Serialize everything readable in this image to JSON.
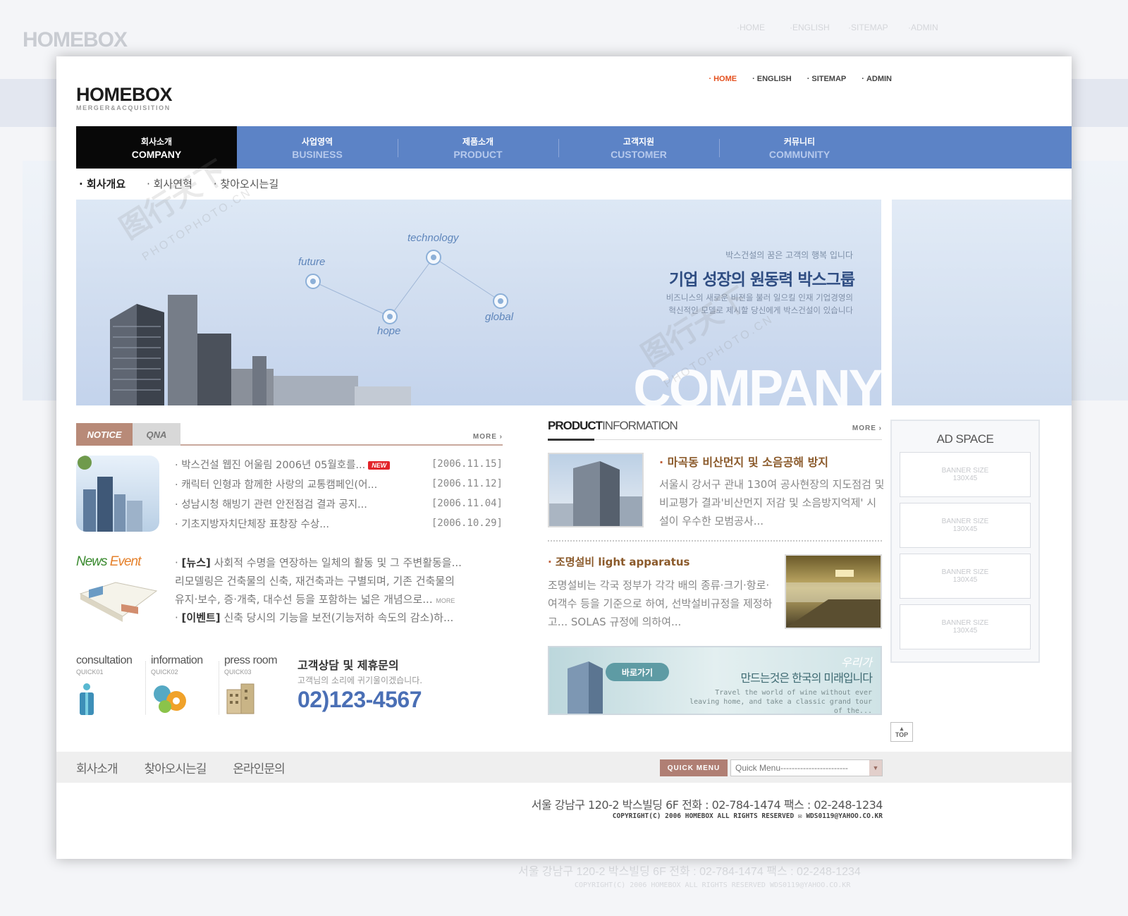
{
  "background": {
    "logo": "HOMEBOX",
    "nav": [
      "·HOME",
      "·ENGLISH",
      "·SITEMAP",
      "·ADMIN"
    ],
    "address": "서울 강남구 120-2 박스빌딩 6F    전화 : 02-784-1474    팩스 : 02-248-1234",
    "copyright": "COPYRIGHT(C) 2006 HOMEBOX ALL RIGHTS RESERVED  WDS0119@YAHOO.CO.KR"
  },
  "header": {
    "logo_main": "HOMEBOX",
    "logo_sub": "MERGER&ACQUISITION",
    "top_nav": [
      {
        "label": "HOME",
        "active": true
      },
      {
        "label": "ENGLISH",
        "active": false
      },
      {
        "label": "SITEMAP",
        "active": false
      },
      {
        "label": "ADMIN",
        "active": false
      }
    ]
  },
  "main_nav": [
    {
      "ko": "회사소개",
      "en": "COMPANY",
      "active": true
    },
    {
      "ko": "사업영역",
      "en": "BUSINESS",
      "active": false
    },
    {
      "ko": "제품소개",
      "en": "PRODUCT",
      "active": false
    },
    {
      "ko": "고객지원",
      "en": "CUSTOMER",
      "active": false
    },
    {
      "ko": "커뮤니티",
      "en": "COMMUNITY",
      "active": false
    }
  ],
  "sub_nav": [
    {
      "label": "회사개요",
      "active": true
    },
    {
      "label": "회사연혁",
      "active": false
    },
    {
      "label": "찾아오시는길",
      "active": false
    }
  ],
  "banner": {
    "nodes": [
      "future",
      "technology",
      "hope",
      "global"
    ],
    "subtitle": "박스건설의 꿈은 고객의 행복 입니다",
    "title": "기업 성장의 원동력 박스그룹",
    "desc1": "비즈니스의 새로운 비젼을 불러 일으킬 인재 기업경영의",
    "desc2": "혁신적인 모델로 제시할 당신에게 박스건설이 있습니다",
    "big_word": "COMPANY"
  },
  "notice": {
    "tabs": [
      "NOTICE",
      "QNA"
    ],
    "more": "MORE ›",
    "new_badge": "NEW",
    "items": [
      {
        "title": "박스건설 웹진 어울림 2006년 05월호를...",
        "date": "[2006.11.15]"
      },
      {
        "title": "캐릭터 인형과 함께한 사랑의 교통캠페인(어...",
        "date": "[2006.11.12]"
      },
      {
        "title": "성남시청 해빙기 관련 안전점검 결과 공지...",
        "date": "[2006.11.04]"
      },
      {
        "title": "기초지방자치단체장 표창장 수상...",
        "date": "[2006.10.29]"
      }
    ]
  },
  "news": {
    "title_a": "News",
    "title_b": "Event",
    "item1_tag": "[뉴스]",
    "item1_line1": " 사회적 수명을 연장하는 일체의 활동 및 그 주변활동을...",
    "item1_line2": "리모델링은 건축물의 신축, 재건축과는 구별되며, 기존 건축물의",
    "item1_line3": "유지·보수, 증·개축, 대수선 등을 포함하는 넓은 개념으로... ",
    "more": "MORE",
    "item2_tag": "[이벤트]",
    "item2_line1": " 신축 당시의 기능을 보전(기능저하 속도의 감소)하..."
  },
  "quick": [
    {
      "title": "consultation",
      "sub": "QUICK01"
    },
    {
      "title": "information",
      "sub": "QUICK02"
    },
    {
      "title": "press room",
      "sub": "QUICK03"
    }
  ],
  "contact": {
    "title": "고객상담 및 제휴문의",
    "sub": "고객님의 소리에 귀기울이겠습니다.",
    "phone": "02)123-4567"
  },
  "product": {
    "head_bold": "PRODUCT",
    "head_rest": "INFORMATION",
    "more": "MORE ›",
    "item1_title": "마곡동 비산먼지 및 소음공해 방지",
    "item1_desc": "서울시 강서구 관내 130여 공사현장의 지도점검 및 비교평가 결과'비산먼지 저감 및 소음방지억제' 시설이 우수한 모범공사...",
    "item2_title": "조명설비 light apparatus",
    "item2_desc": "조명설비는 각국 정부가 각각 배의 종류·크기·항로·여객수 등을 기준으로 하여, 선박설비규정을 제정하고... SOLAS 규정에 의하여..."
  },
  "promo": {
    "button": "바로가기",
    "tag": "우리가",
    "title": "만드는것은 한국의 미래입니다",
    "en": "Travel the world of wine without ever leaving home, and take a classic grand tour of the..."
  },
  "ad": {
    "title": "AD SPACE",
    "slots": [
      {
        "l1": "BANNER SIZE",
        "l2": "130X45"
      },
      {
        "l1": "BANNER SIZE",
        "l2": "130X45"
      },
      {
        "l1": "BANNER SIZE",
        "l2": "130X45"
      },
      {
        "l1": "BANNER SIZE",
        "l2": "130X45"
      }
    ],
    "top_label": "TOP"
  },
  "footer": {
    "links": [
      "회사소개",
      "찾아오시는길",
      "온라인문의"
    ],
    "quick_menu_label": "QUICK MENU",
    "quick_menu_value": "Quick Menu------------------------",
    "address": "서울 강남구 120-2 박스빌딩 6F    전화 : 02-784-1474    팩스 : 02-248-1234",
    "copyright": "COPYRIGHT(C) 2006 HOMEBOX ALL RIGHTS RESERVED  ✉ WDS0119@YAHOO.CO.KR"
  },
  "watermark": {
    "brand": "图行天下",
    "site": "PHOTOPHOTO.CN"
  },
  "colors": {
    "nav_blue": "#5c83c6",
    "home_orange": "#e4501e",
    "notice_brown": "#b88a78",
    "phone_blue": "#4a6fb5"
  }
}
